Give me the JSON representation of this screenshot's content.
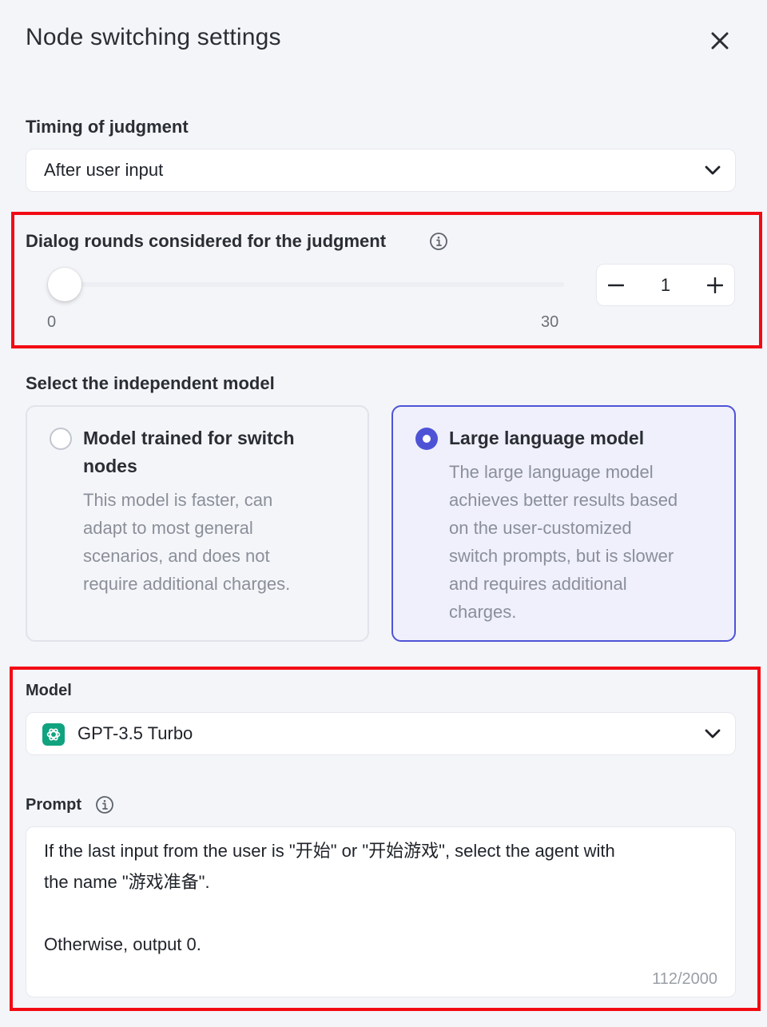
{
  "header": {
    "title": "Node switching settings"
  },
  "timing": {
    "label": "Timing of judgment",
    "selected": "After user input"
  },
  "dialog_rounds": {
    "label": "Dialog rounds considered for the judgment",
    "min": "0",
    "max": "30",
    "value": "1",
    "value_fraction": 0.0
  },
  "independent_model": {
    "label": "Select the independent model",
    "options": [
      {
        "title_line1": "Model trained for switch",
        "title_line2": "nodes",
        "desc": [
          "This model is faster, can",
          "adapt to most general",
          "scenarios, and does not",
          "require additional charges."
        ],
        "selected": false
      },
      {
        "title_line1": "Large language model",
        "desc": [
          "The large language model",
          "achieves better results based",
          "on the user-customized",
          "switch prompts, but is slower",
          "and requires additional",
          "charges."
        ],
        "selected": true
      }
    ]
  },
  "model": {
    "label": "Model",
    "selected": "GPT-3.5 Turbo",
    "icon": "openai-icon"
  },
  "prompt": {
    "label": "Prompt",
    "text": "If the last input from the user is \"开始\" or \"开始游戏\", select the agent with\nthe name \"游戏准备\".\n\nOtherwise, output 0.",
    "counter": "112/2000"
  },
  "colors": {
    "accent": "#4e53d6",
    "highlight": "#f20b14",
    "openai": "#10a37f"
  }
}
